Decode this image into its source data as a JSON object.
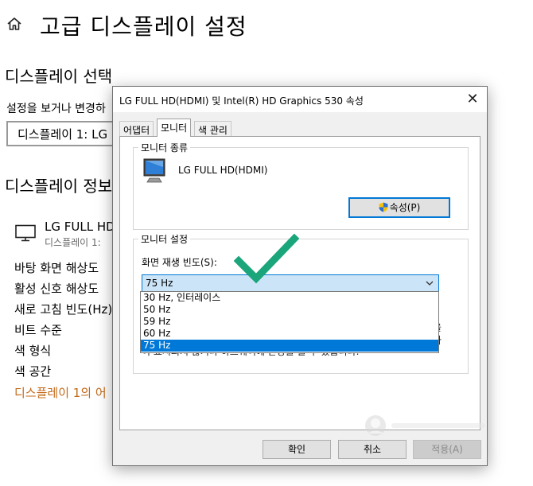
{
  "page": {
    "title": "고급 디스플레이 설정",
    "select_display_heading": "디스플레이 선택",
    "select_display_label": "설정을 보거나 변경하",
    "display_select_value": "디스플레이 1: LG",
    "display_info_heading": "디스플레이 정보",
    "monitor_name": "LG FULL HD(",
    "monitor_sub": "디스플레이 1: ",
    "info_rows": [
      "바탕 화면 해상도",
      "활성 신호 해상도",
      "새로 고침 빈도(Hz)",
      "비트 수준",
      "색 형식",
      "색 공간"
    ],
    "adapter_link": "디스플레이 1의 어"
  },
  "dialog": {
    "title": "LG FULL HD(HDMI) 및 Intel(R) HD Graphics 530 속성",
    "close": "✕",
    "tabs": [
      "어댑터",
      "모니터",
      "색 관리"
    ],
    "active_tab": "모니터",
    "monitor_type_group": "모니터 종류",
    "monitor_name": "LG FULL HD(HDMI)",
    "properties_button": "속성(P)",
    "monitor_settings_group": "모니터 설정",
    "refresh_rate_label": "화면 재생 빈도(S):",
    "refresh_rate_value": "75 Hz",
    "refresh_options": [
      "30 Hz, 인터레이스",
      "50 Hz",
      "59 Hz",
      "60 Hz",
      "75 Hz"
    ],
    "selected_option": "75 Hz",
    "partial_text_1": "을",
    "partial_text_2": "나",
    "partial_text_3": "이 표시되지 않거나 하드웨어에 손상을 줄 수 있습니다.",
    "ok_button": "확인",
    "cancel_button": "취소",
    "apply_button": "적용(A)"
  },
  "colors": {
    "accent": "#0078d7",
    "selection_bg": "#cce4f7",
    "checkmark": "#1aa57a",
    "link": "#c46a1a"
  },
  "icons": [
    "home-icon",
    "monitor-icon",
    "shield-icon",
    "chevron-down-icon",
    "close-icon",
    "checkmark-icon"
  ]
}
